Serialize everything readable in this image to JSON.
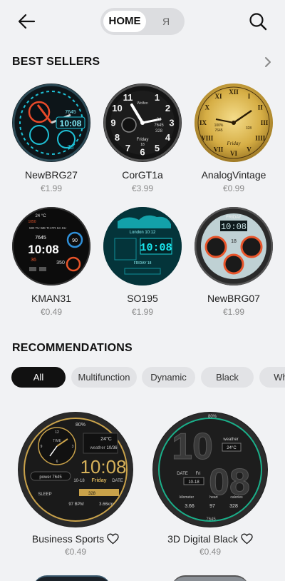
{
  "header": {
    "tab_home": "HOME",
    "tab_ya": "Я"
  },
  "best_sellers": {
    "title": "BEST SELLERS",
    "items": [
      {
        "name": "NewBRG27",
        "price": "€1.99"
      },
      {
        "name": "CorGT1a",
        "price": "€3.99"
      },
      {
        "name": "AnalogVintage",
        "price": "€0.99"
      },
      {
        "name": "KMAN31",
        "price": "€0.49"
      },
      {
        "name": "SO195",
        "price": "€1.99"
      },
      {
        "name": "NewBRG07",
        "price": "€1.99"
      }
    ]
  },
  "faces": {
    "newbrg27": {
      "time": "10:08",
      "steps": "7645",
      "num": "78"
    },
    "corgt1a": {
      "brand": "Wolfen",
      "day": "Friday",
      "date": "18",
      "n1": "24",
      "n2": "7645",
      "n3": "328",
      "hours": [
        "12",
        "1",
        "2",
        "3",
        "4",
        "5",
        "6",
        "7",
        "8",
        "9",
        "10",
        "11"
      ]
    },
    "vintage": {
      "day": "Friday",
      "n1": "100%",
      "n2": "7645",
      "n3": "328",
      "numerals": [
        "XII",
        "I",
        "II",
        "III",
        "IIII",
        "V",
        "VI",
        "VII",
        "VIII",
        "IX",
        "X",
        "XI"
      ]
    },
    "kman31": {
      "days": "MO TU WE TH FR SA SU",
      "temp": "24 °C",
      "time": "10:08",
      "steps": "7645",
      "dist": "1050",
      "n1": "90",
      "n2": "350",
      "n3": "36"
    },
    "so195": {
      "city": "London 10:12",
      "time": "10:08",
      "sub": "FRIDAY 18"
    },
    "newbrg07": {
      "day": "FRIDAY",
      "time": "10:08",
      "date": "18"
    }
  },
  "recommendations": {
    "title": "RECOMMENDATIONS",
    "chips": [
      "All",
      "Multifunction",
      "Dynamic",
      "Black",
      "Wh"
    ],
    "items": [
      {
        "name": "Business Sports",
        "price": "€0.49"
      },
      {
        "name": "3D Digital Black",
        "price": "€0.49"
      }
    ]
  },
  "rec_faces": {
    "business": {
      "battery": "80%",
      "temp": "24°C",
      "weather": "weather",
      "date": "10/36",
      "time": "10:08",
      "d": "10-18",
      "day": "Friday",
      "dlabel": "DATE",
      "power": "power 7645",
      "sleep": "SLEEP",
      "cal": "328",
      "bpm": "97 BPM",
      "km": "3.66km",
      "time_lbl": "TIME",
      "n12": "12",
      "n3": "3",
      "n6": "6",
      "n9": "9"
    },
    "digital3d": {
      "battery": "80%",
      "hour": "10",
      "min": "08",
      "weather": "weather",
      "temp": "24°C",
      "date_lbl": "DATE",
      "fri": "Fri",
      "date": "10-18",
      "km": "3.66",
      "bpm": "97",
      "cal": "328",
      "steps": "7645",
      "kilometer": "kilometer",
      "heart": "heart",
      "calories": "calories"
    }
  },
  "colors": {
    "accent_dark": "#111111",
    "chip_bg": "#e2e3e6",
    "price_grey": "#8a8a8a",
    "bg": "#f1f2f4"
  }
}
